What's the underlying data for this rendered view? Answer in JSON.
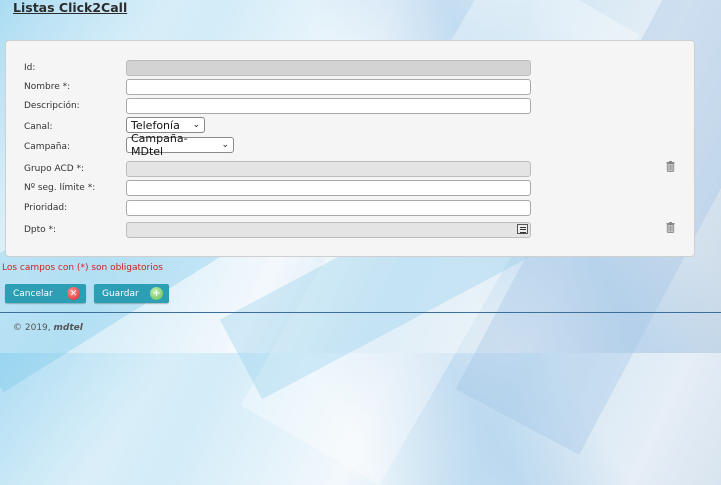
{
  "title": "Listas Click2Call",
  "form": {
    "id_label": "Id:",
    "nombre_label": "Nombre *:",
    "descripcion_label": "Descripción:",
    "canal_label": "Canal:",
    "canal_value": "Telefonía",
    "campana_label": "Campaña:",
    "campana_value": "Campaña-MDtel",
    "grupo_label": "Grupo ACD *:",
    "seg_label": "Nº seg. límite *:",
    "prioridad_label": "Prioridad:",
    "dpto_label": "Dpto *:"
  },
  "required_note": "Los campos con (*) son obligatorios",
  "buttons": {
    "cancel": "Cancelar",
    "save": "Guardar"
  },
  "footer": {
    "copyright": "© 2019,",
    "brand": "mdtel"
  },
  "colors": {
    "button": "#2d9fb5",
    "required_text": "#d32020",
    "footer_line": "#3b6e99"
  }
}
